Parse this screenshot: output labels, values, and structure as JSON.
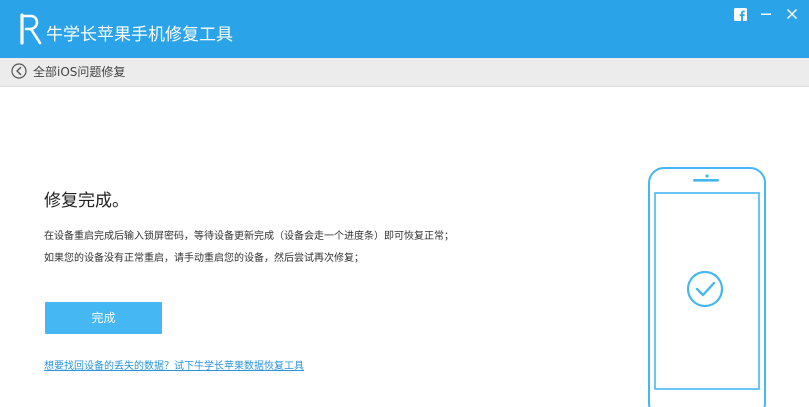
{
  "app": {
    "title": "牛学长苹果手机修复工具",
    "logo_icon": "r-logo-icon",
    "brand_color": "#2aa3e8"
  },
  "window_controls": [
    "facebook-icon",
    "minimize-icon",
    "close-icon"
  ],
  "nav": {
    "back_icon": "back-arrow-icon",
    "title": "全部iOS问题修复"
  },
  "result": {
    "title": "修复完成。",
    "line1": "在设备重启完成后输入锁屏密码，等待设备更新完成（设备会走一个进度条）即可恢复正常；",
    "line2": "如果您的设备没有正常重启，请手动重启您的设备，然后尝试再次修复；",
    "done_button": "完成",
    "recover_link": "想要找回设备的丢失的数据？试下牛学长苹果数据恢复工具"
  },
  "illustration": {
    "icon": "phone-check-icon",
    "accent_color": "#45b8f3"
  }
}
